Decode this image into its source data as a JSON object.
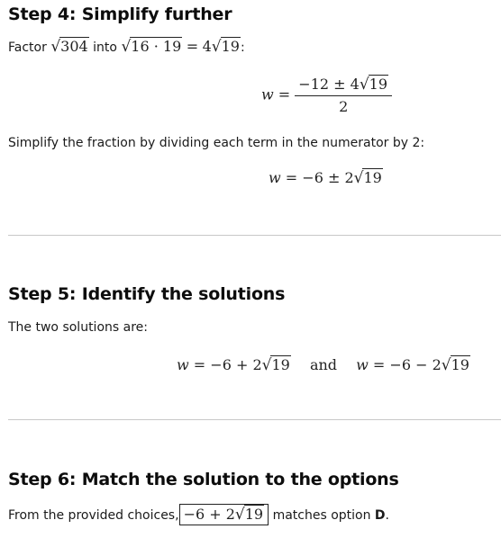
{
  "steps": [
    {
      "heading": "Step 4: Simplify further",
      "intro": {
        "prefix": "Factor",
        "radicand_a": "304",
        "middle": "into",
        "radicand_b": "16 · 19",
        "equals": "=",
        "coef": "4",
        "radicand_c": "19",
        "suffix": ":"
      },
      "equation1": {
        "lhs": "w",
        "eq": "=",
        "numerator_prefix": "−12 ± 4",
        "numerator_radicand": "19",
        "denominator": "2"
      },
      "explain": "Simplify the fraction by dividing each term in the numerator by 2:",
      "equation2": {
        "lhs": "w",
        "eq": "=",
        "rhs_prefix": "−6 ± 2",
        "rhs_radicand": "19"
      }
    },
    {
      "heading": "Step 5: Identify the solutions",
      "intro": "The two solutions are:",
      "solutions": {
        "first": {
          "lhs": "w",
          "eq": "=",
          "rhs_prefix": "−6 + 2",
          "rhs_radicand": "19"
        },
        "connector": "and",
        "second": {
          "lhs": "w",
          "eq": "=",
          "rhs_prefix": "−6 − 2",
          "rhs_radicand": "19"
        }
      }
    },
    {
      "heading": "Step 6: Match the solution to the options",
      "sentence": {
        "prefix": "From the provided choices,",
        "boxed_prefix": "−6 + 2",
        "boxed_radicand": "19",
        "middle": "matches option",
        "option": "D",
        "suffix": "."
      }
    }
  ]
}
